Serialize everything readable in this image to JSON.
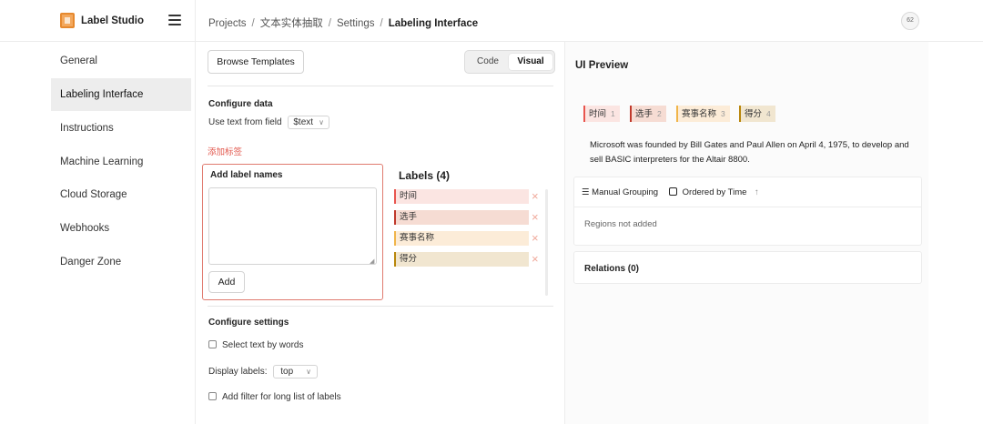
{
  "app": {
    "name": "Label Studio"
  },
  "header": {
    "breadcrumb": [
      "Projects",
      "文本实体抽取",
      "Settings",
      "Labeling Interface"
    ],
    "separator": "/",
    "avatar_initials": "62"
  },
  "sidebar": {
    "items": [
      {
        "label": "General",
        "active": false
      },
      {
        "label": "Labeling Interface",
        "active": true
      },
      {
        "label": "Instructions",
        "active": false
      },
      {
        "label": "Machine Learning",
        "active": false
      },
      {
        "label": "Cloud Storage",
        "active": false
      },
      {
        "label": "Webhooks",
        "active": false
      },
      {
        "label": "Danger Zone",
        "active": false
      }
    ]
  },
  "config": {
    "browse_templates_label": "Browse Templates",
    "view_toggle": {
      "code_label": "Code",
      "visual_label": "Visual",
      "selected": "Visual"
    },
    "configure_data_title": "Configure data",
    "use_text_from_field_label": "Use text from field",
    "field_value": "$text",
    "add_label_link": "添加标签",
    "add_label_names_title": "Add label names",
    "textarea_value": "",
    "add_button_label": "Add",
    "labels_title": "Labels (4)",
    "labels": [
      {
        "name": "时间",
        "color": "#e8554e",
        "bg": "#fbe5e2"
      },
      {
        "name": "选手",
        "color": "#c0392b",
        "bg": "#f6dcd3"
      },
      {
        "name": "赛事名称",
        "color": "#f0b54a",
        "bg": "#fcecd8"
      },
      {
        "name": "得分",
        "color": "#b8860b",
        "bg": "#f1e6d0"
      }
    ],
    "remove_glyph": "×",
    "configure_settings_title": "Configure settings",
    "select_text_by_words": {
      "label": "Select text by words",
      "checked": false
    },
    "display_labels": {
      "label": "Display labels:",
      "value": "top"
    },
    "add_filter": {
      "label": "Add filter for long list of labels",
      "checked": false
    }
  },
  "preview": {
    "title": "UI Preview",
    "label_tags": [
      {
        "name": "时间",
        "hotkey": "1"
      },
      {
        "name": "选手",
        "hotkey": "2"
      },
      {
        "name": "赛事名称",
        "hotkey": "3"
      },
      {
        "name": "得分",
        "hotkey": "4"
      }
    ],
    "text": "Microsoft was founded by Bill Gates and Paul Allen on April 4, 1975, to develop and sell BASIC interpreters for the Altair 8800.",
    "regions_toolbar": {
      "grouping_label": "Manual Grouping",
      "ordering_label": "Ordered by Time",
      "sort_direction": "↑"
    },
    "regions_empty": "Regions not added",
    "relations_title": "Relations (0)"
  }
}
